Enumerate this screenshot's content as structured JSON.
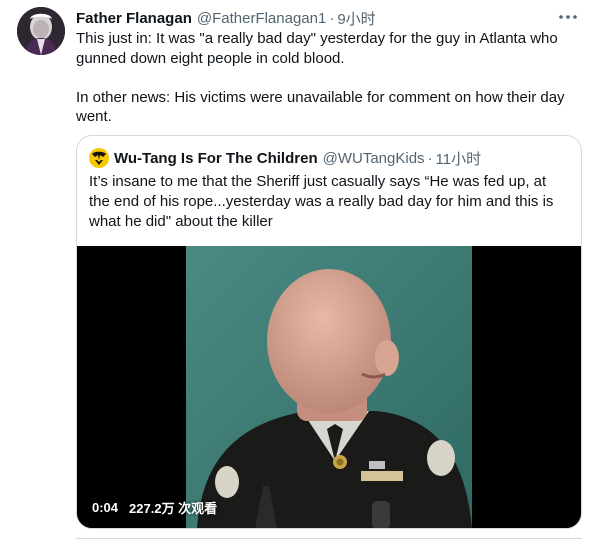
{
  "tweet": {
    "display_name": "Father Flanagan",
    "handle": "@FatherFlanagan1",
    "separator": "·",
    "time": "9小时",
    "more_icon": "more-horizontal-icon",
    "paragraphs": [
      "This just in: It was \"a really bad day\" yesterday for the guy in Atlanta who gunned down eight people in cold blood.",
      "In other news: His victims were unavailable for comment on how their day went."
    ]
  },
  "quote": {
    "display_name": "Wu-Tang Is For The Children",
    "handle": "@WUTangKids",
    "separator": "·",
    "time": "11小时",
    "avatar_icon": "wu-tang-logo-icon",
    "text": "It’s insane to me that the Sheriff just casually says “He was fed up, at the end of his rope...yesterday was a really bad day for him and this is what he did\" about the killer",
    "video": {
      "elapsed": "0:04",
      "views": "227.2万 次观看"
    }
  },
  "colors": {
    "text_primary": "#0f1419",
    "text_secondary": "#536471",
    "border": "#cfd9de",
    "video_bg": "#000000",
    "wutang_yellow": "#f7c800"
  }
}
